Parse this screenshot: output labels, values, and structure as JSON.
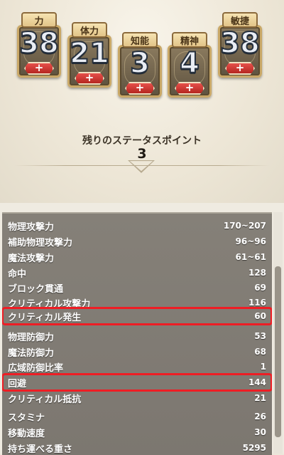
{
  "stats": [
    {
      "label": "力",
      "value": "38",
      "plus": "+"
    },
    {
      "label": "体力",
      "value": "21",
      "plus": "+"
    },
    {
      "label": "知能",
      "value": "3",
      "plus": "+"
    },
    {
      "label": "精神",
      "value": "4",
      "plus": "+"
    },
    {
      "label": "敏捷",
      "value": "38",
      "plus": "+"
    }
  ],
  "status_points": {
    "label": "残りのステータスポイント",
    "value": "3"
  },
  "attributes": [
    {
      "name": "物理攻撃力",
      "value": "170~207"
    },
    {
      "name": "補助物理攻撃力",
      "value": "96~96"
    },
    {
      "name": "魔法攻撃力",
      "value": "61~61"
    },
    {
      "name": "命中",
      "value": "128"
    },
    {
      "name": "ブロック貫通",
      "value": "69"
    },
    {
      "name": "クリティカル攻撃力",
      "value": "116"
    },
    {
      "name": "クリティカル発生",
      "value": "60"
    },
    {
      "name": "物理防御力",
      "value": "53"
    },
    {
      "name": "魔法防御力",
      "value": "68"
    },
    {
      "name": "広域防御比率",
      "value": "1"
    },
    {
      "name": "回避",
      "value": "144"
    },
    {
      "name": "クリティカル抵抗",
      "value": "21"
    },
    {
      "name": "スタミナ",
      "value": "26"
    },
    {
      "name": "移動速度",
      "value": "30"
    },
    {
      "name": "持ち運べる重さ",
      "value": "5295"
    }
  ],
  "colors": {
    "highlight": "#ee1d24",
    "plus_button": "#d33a34",
    "list_bg": "#817c74"
  }
}
